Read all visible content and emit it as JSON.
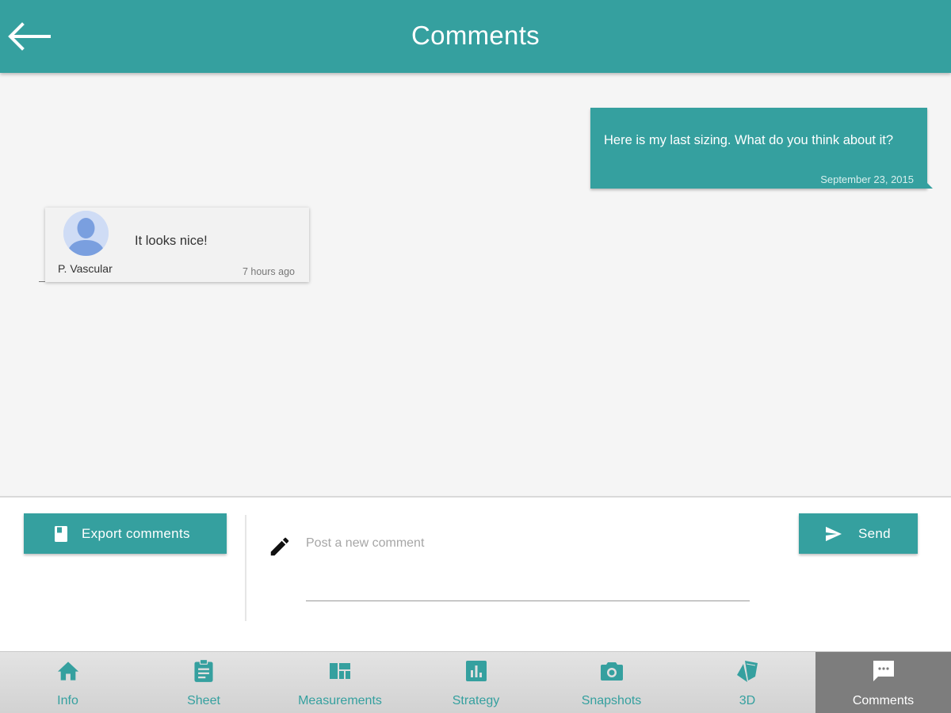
{
  "header": {
    "title": "Comments",
    "back_icon": "arrow-back-icon"
  },
  "thread": {
    "outgoing": {
      "text": "Here is my last sizing. What do you think about it?",
      "timestamp": "September 23, 2015"
    },
    "incoming": {
      "text": "It looks nice!",
      "author": "P. Vascular",
      "timestamp": "7 hours ago",
      "avatar_icon": "person-avatar-icon"
    }
  },
  "composer": {
    "export_label": "Export comments",
    "export_icon": "book-icon",
    "placeholder": "Post a new comment",
    "value": "",
    "pencil_icon": "pencil-icon",
    "send_label": "Send",
    "send_icon": "send-icon"
  },
  "nav": {
    "items": [
      {
        "label": "Info",
        "icon": "home-icon"
      },
      {
        "label": "Sheet",
        "icon": "clipboard-icon"
      },
      {
        "label": "Measurements",
        "icon": "dashboard-icon"
      },
      {
        "label": "Strategy",
        "icon": "bar-chart-icon"
      },
      {
        "label": "Snapshots",
        "icon": "camera-icon"
      },
      {
        "label": "3D",
        "icon": "cards-3d-icon"
      },
      {
        "label": "Comments",
        "icon": "chat-icon"
      }
    ],
    "active": "Comments"
  },
  "colors": {
    "primary": "#35a09f",
    "background": "#f5f5f5",
    "nav_active": "#7d7d7d"
  }
}
